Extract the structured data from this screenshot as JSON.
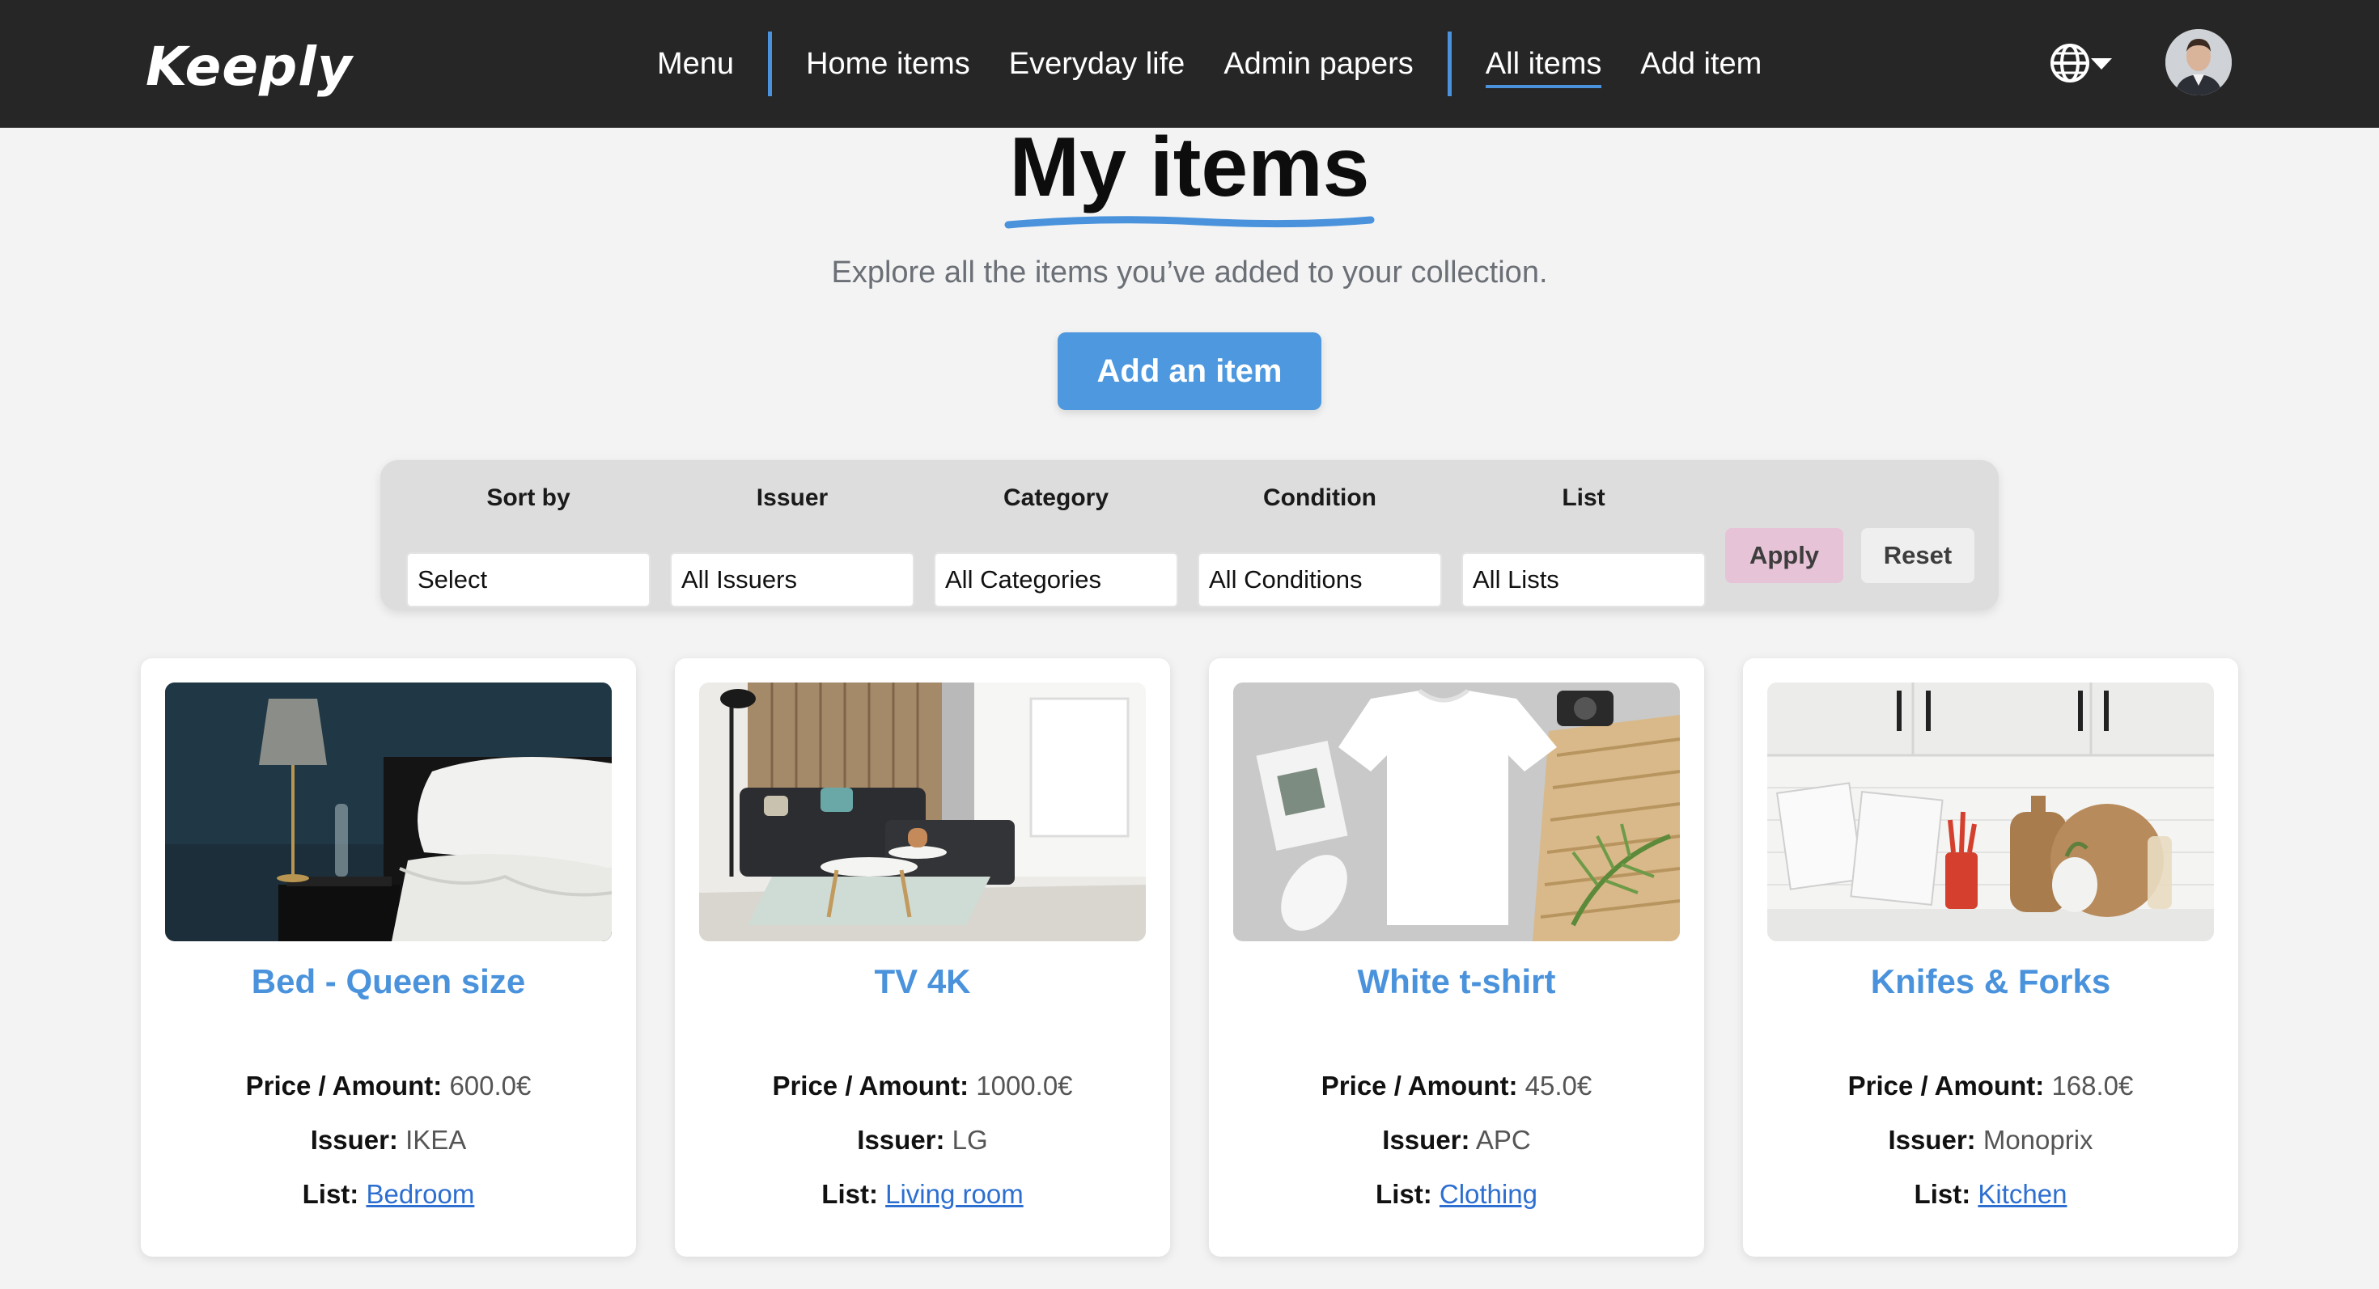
{
  "app": {
    "logo": "Keeply"
  },
  "nav": {
    "menu": "Menu",
    "home_items": "Home items",
    "everyday_life": "Everyday life",
    "admin_papers": "Admin papers",
    "all_items": "All items",
    "add_item": "Add item"
  },
  "header": {
    "title": "My items",
    "subtitle": "Explore all the items you’ve added to your collection.",
    "add_button": "Add an item"
  },
  "filters": {
    "sort_by": {
      "label": "Sort by",
      "value": "Select"
    },
    "issuer": {
      "label": "Issuer",
      "value": "All Issuers"
    },
    "category": {
      "label": "Category",
      "value": "All Categories"
    },
    "condition": {
      "label": "Condition",
      "value": "All Conditions"
    },
    "list": {
      "label": "List",
      "value": "All Lists"
    },
    "apply": "Apply",
    "reset": "Reset"
  },
  "field_labels": {
    "price": "Price / Amount:",
    "issuer": "Issuer:",
    "list": "List:"
  },
  "items": [
    {
      "title": "Bed - Queen size",
      "price": "600.0€",
      "issuer": "IKEA",
      "list": "Bedroom",
      "image": "bedroom-photo"
    },
    {
      "title": "TV 4K",
      "price": "1000.0€",
      "issuer": "LG",
      "list": "Living room",
      "image": "living-room-photo"
    },
    {
      "title": "White t-shirt",
      "price": "45.0€",
      "issuer": "APC",
      "list": "Clothing",
      "image": "tshirt-photo"
    },
    {
      "title": "Knifes & Forks",
      "price": "168.0€",
      "issuer": "Monoprix",
      "list": "Kitchen",
      "image": "kitchen-photo"
    }
  ],
  "colors": {
    "topbar": "#262626",
    "accent": "#4a93dc",
    "apply_button": "#e6c3d6",
    "background": "#f3f3f3"
  }
}
